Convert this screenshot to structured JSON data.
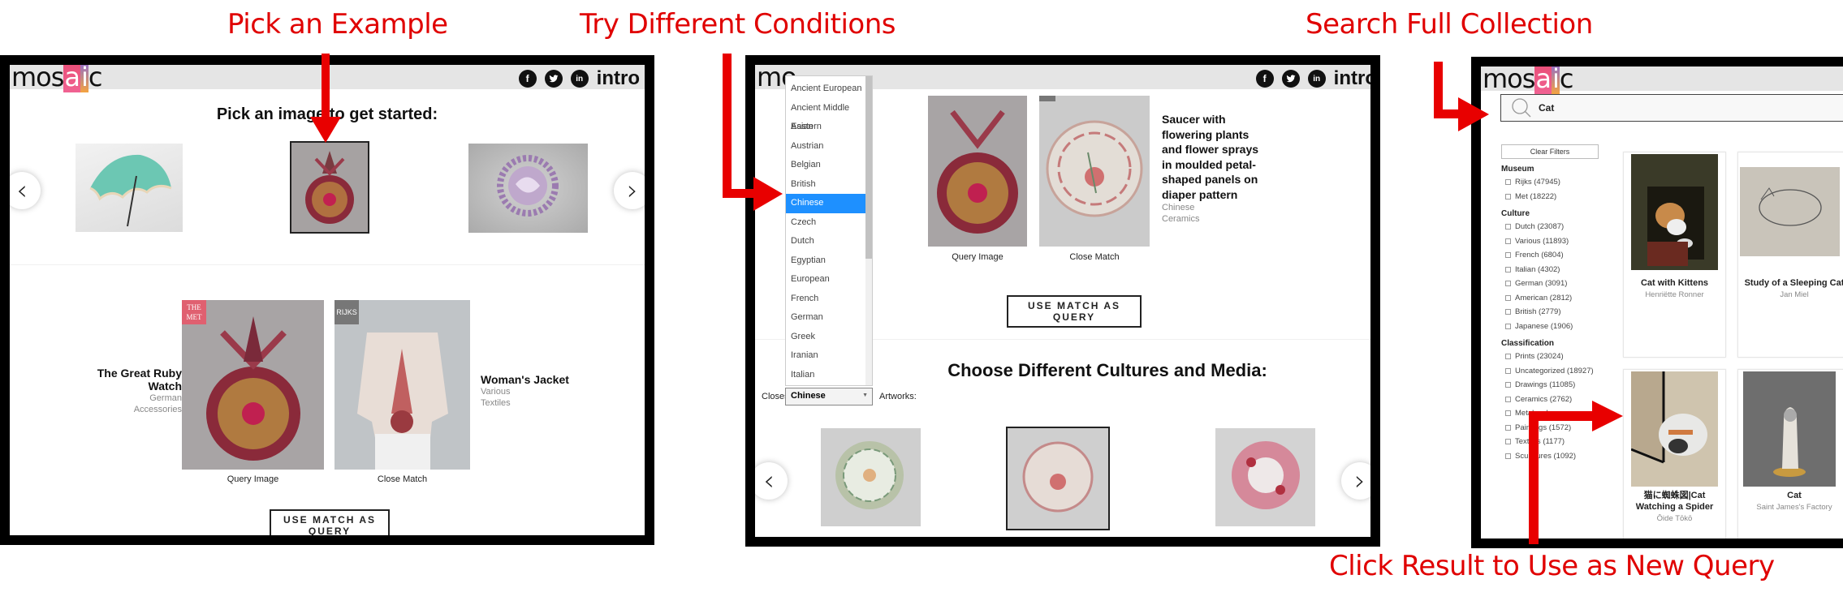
{
  "annotations": {
    "pick_example": "Pick an Example",
    "try_conditions": "Try Different Conditions",
    "search_collection": "Search Full Collection",
    "click_result": "Click Result to Use as New Query"
  },
  "brand": {
    "logo_prefix": "mos",
    "logo_a": "a",
    "logo_i": "i",
    "logo_suffix": "c",
    "logo_partial": "mo",
    "intro_label": "intro",
    "social": [
      "f",
      "t",
      "in"
    ]
  },
  "panel1": {
    "heading": "Pick an image to get started:",
    "carousel": [
      {
        "name": "Umbrella",
        "color": "#6cc0ac"
      },
      {
        "name": "The Great Ruby Watch",
        "color": "#a8324a",
        "selected": true
      },
      {
        "name": "Glass dish",
        "color": "#9b7fb0"
      }
    ],
    "query": {
      "title": "The Great Ruby Watch",
      "culture": "German",
      "classification": "Accessories",
      "caption": "Query Image",
      "badge": "THE MET"
    },
    "match": {
      "title": "Woman's Jacket",
      "culture": "Various",
      "classification": "Textiles",
      "caption": "Close Match",
      "badge": "RIJKS"
    },
    "use_match_button": "USE MATCH AS QUERY"
  },
  "panel2": {
    "query_caption": "Query Image",
    "match_caption": "Close Match",
    "match": {
      "title": "Saucer with flowering plants and flower sprays in moulded petal-shaped panels on diaper pattern",
      "culture": "Chinese",
      "classification": "Ceramics"
    },
    "use_match_button": "USE MATCH AS QUERY",
    "section_heading": "Choose Different Cultures and Media:",
    "closest_label": "Closest",
    "artworks_label": "Artworks:",
    "culture_select": {
      "selected": "Chinese",
      "options": [
        "Ancient European",
        "Ancient Middle Eastern",
        "Asian",
        "Austrian",
        "Belgian",
        "British",
        "Chinese",
        "Czech",
        "Dutch",
        "Egyptian",
        "European",
        "French",
        "German",
        "Greek",
        "Iranian",
        "Italian"
      ]
    },
    "results": [
      {
        "name": "Green saucer"
      },
      {
        "name": "Floral saucer",
        "selected": true
      },
      {
        "name": "Pink saucer"
      }
    ]
  },
  "panel3": {
    "search": {
      "value": "Cat"
    },
    "clear_filters": "Clear Filters",
    "filters": [
      {
        "heading": "Museum",
        "items": [
          "Rijks (47945)",
          "Met (18222)"
        ]
      },
      {
        "heading": "Culture",
        "items": [
          "Dutch (23087)",
          "Various (11893)",
          "French (6804)",
          "Italian (4302)",
          "German (3091)",
          "American (2812)",
          "British (2779)",
          "Japanese (1906)"
        ]
      },
      {
        "heading": "Classification",
        "items": [
          "Prints (23024)",
          "Uncategorized (18927)",
          "Drawings (11085)",
          "Ceramics (2762)",
          "Metalwork",
          "Paintings (1572)",
          "Textiles (1177)",
          "Sculptures (1092)"
        ]
      }
    ],
    "results": [
      {
        "title": "Cat with Kittens",
        "artist": "Henriëtte Ronner"
      },
      {
        "title": "Study of a Sleeping Cat",
        "artist": "Jan Miel"
      },
      {
        "title": "猫に蜘蛛図|Cat Watching a Spider",
        "artist": "Ōide Tōkō"
      },
      {
        "title": "Cat",
        "artist": "Saint James's Factory"
      }
    ]
  }
}
